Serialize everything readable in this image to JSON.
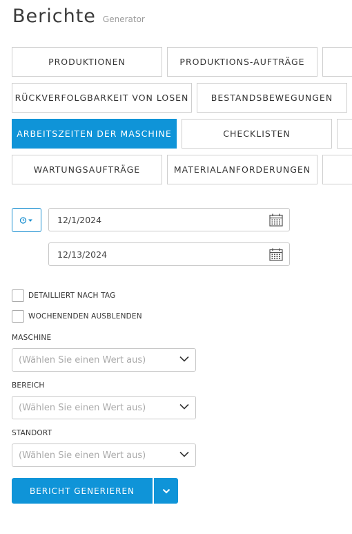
{
  "header": {
    "title": "Berichte",
    "subtitle": "Generator"
  },
  "reports": {
    "buttons": [
      {
        "label": "PRODUKTIONEN"
      },
      {
        "label": "PRODUKTIONS-AUFTRÄGE"
      },
      {
        "label": ""
      },
      {
        "label": "RÜCKVERFOLGBARKEIT VON LOSEN"
      },
      {
        "label": "BESTANDSBEWEGUNGEN"
      },
      {
        "label": "ARBEITSZEITEN DER MASCHINE",
        "active": true
      },
      {
        "label": "CHECKLISTEN"
      },
      {
        "label": ""
      },
      {
        "label": "WARTUNGSAUFTRÄGE"
      },
      {
        "label": "MATERIALANFORDERUNGEN"
      },
      {
        "label": ""
      }
    ]
  },
  "date_range": {
    "preset_icon": "clock-icon",
    "start": "12/1/2024",
    "end": "12/13/2024",
    "calendar_icon": "calendar-icon"
  },
  "options": {
    "daily_detail": {
      "label": "DETAILLIERT NACH TAG",
      "checked": false
    },
    "hide_weekends": {
      "label": "WOCHENENDEN AUSBLENDEN",
      "checked": false
    }
  },
  "filters": {
    "machine": {
      "label": "MASCHINE",
      "placeholder": "(Wählen Sie einen Wert aus)"
    },
    "area": {
      "label": "BEREICH",
      "placeholder": "(Wählen Sie einen Wert aus)"
    },
    "location": {
      "label": "STANDORT",
      "placeholder": "(Wählen Sie einen Wert aus)"
    }
  },
  "actions": {
    "generate_label": "BERICHT GENERIEREN"
  },
  "colors": {
    "accent": "#0f94d8"
  }
}
